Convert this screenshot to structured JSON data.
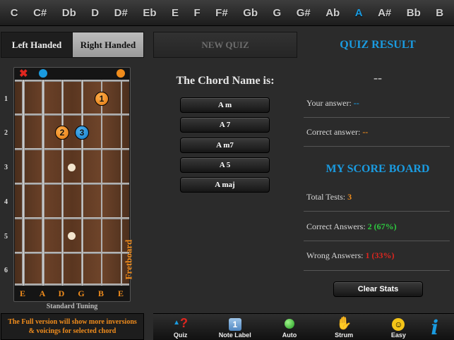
{
  "notes": [
    "C",
    "C#",
    "Db",
    "D",
    "D#",
    "Eb",
    "E",
    "F",
    "F#",
    "Gb",
    "G",
    "G#",
    "Ab",
    "A",
    "A#",
    "Bb",
    "B"
  ],
  "active_note": "A",
  "hand": {
    "left_label": "Left Handed",
    "right_label": "Right Handed",
    "selected": "Right Handed"
  },
  "fretboard": {
    "fret_numbers": [
      "1",
      "2",
      "3",
      "4",
      "5",
      "6"
    ],
    "string_names": [
      "E",
      "A",
      "D",
      "G",
      "B",
      "E"
    ],
    "tuning_label": "Standard Tuning",
    "side_label": "Fretboard",
    "muted_string": "E (low)",
    "open_strings": [
      "A",
      "E (high)"
    ],
    "fingers": [
      {
        "label": "1",
        "string": 5,
        "fret": 1,
        "color": "orange"
      },
      {
        "label": "2",
        "string": 3,
        "fret": 2,
        "color": "orange"
      },
      {
        "label": "3",
        "string": 4,
        "fret": 2,
        "color": "blue"
      }
    ]
  },
  "full_version_note": "The Full version will show more inversions & voicings for selected chord",
  "quiz": {
    "new_quiz_label": "NEW QUIZ",
    "prompt": "The Chord Name is:",
    "answers": [
      "A m",
      "A 7",
      "A m7",
      "A 5",
      "A maj"
    ]
  },
  "result": {
    "title": "QUIZ RESULT",
    "value": "--",
    "your_answer_label": "Your answer:",
    "your_answer_value": "--",
    "correct_answer_label": "Correct answer:",
    "correct_answer_value": "--"
  },
  "scoreboard": {
    "title": "MY SCORE BOARD",
    "total_label": "Total Tests:",
    "total_value": "3",
    "correct_label": "Correct Answers:",
    "correct_value": "2 (67%)",
    "wrong_label": "Wrong Answers:",
    "wrong_value": "1 (33%)",
    "clear_label": "Clear Stats"
  },
  "toolbar": {
    "quiz": "Quiz",
    "note_label": "Note Label",
    "auto": "Auto",
    "strum": "Strum",
    "easy": "Easy"
  },
  "colors": {
    "accent_blue": "#1a9be0",
    "accent_orange": "#f08c1c",
    "correct_green": "#2ecc40",
    "wrong_red": "#e0261f"
  }
}
